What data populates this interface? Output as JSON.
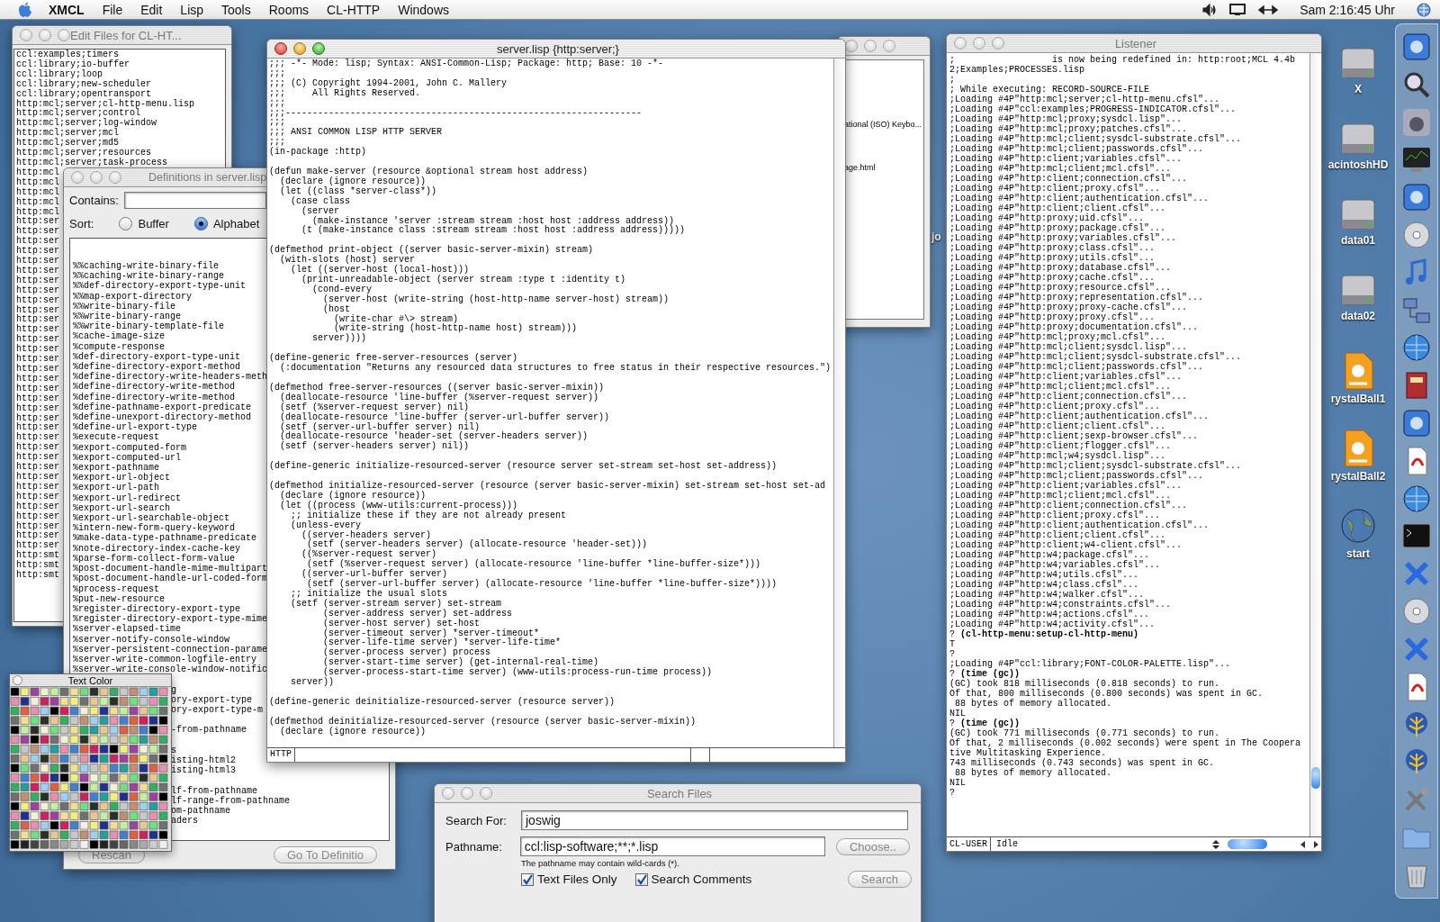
{
  "menu_bar": {
    "app": "XMCL",
    "menus": [
      "File",
      "Edit",
      "Lisp",
      "Tools",
      "Rooms",
      "CL-HTTP",
      "Windows"
    ],
    "clock": "Sam 2:16:45 Uhr"
  },
  "edit_files": {
    "title": "Edit Files for CL-HT...",
    "active": false,
    "items": [
      "ccl:examples;timers",
      "ccl:library;io-buffer",
      "ccl:library;loop",
      "ccl:library;new-scheduler",
      "ccl:library;opentransport",
      "http:mcl;server;cl-http-menu.lisp",
      "http:mcl;server;control",
      "http:mcl;server;log-window",
      "http:mcl;server;mcl",
      "http:mcl;server;md5",
      "http:mcl;server;resources",
      "http:mcl;server;task-process",
      "http:mcl",
      "http:mcl",
      "http:mcl",
      "http:mcl",
      "http:mcl",
      "http:ser",
      "http:ser",
      "http:ser",
      "http:ser",
      "http:ser",
      "http:ser",
      "http:ser",
      "http:ser",
      "http:ser",
      "http:ser",
      "http:ser",
      "http:ser",
      "http:ser",
      "http:ser",
      "http:ser",
      "http:ser",
      "http:ser",
      "http:ser",
      "http:ser",
      "http:ser",
      "http:ser",
      "http:ser",
      "http:ser",
      "http:ser",
      "http:ser",
      "http:ser",
      "http:ser",
      "http:ser",
      "http:ser",
      "http:ser",
      "http:ser",
      "http:ser",
      "http:ser",
      "http:ser",
      "http:smt",
      "http:smt",
      "http:smt"
    ]
  },
  "definitions": {
    "title": "Definitions in server.lisp",
    "active": false,
    "contains_label": "Contains:",
    "sort_label": "Sort:",
    "sort_options": [
      {
        "label": "Buffer",
        "selected": false
      },
      {
        "label": "Alphabet",
        "selected": true
      }
    ],
    "items": [
      {
        "text": "%%caching-write-binary-file",
        "kind": "entry"
      },
      {
        "text": "%%caching-write-binary-range",
        "kind": "entry"
      },
      {
        "text": "%%def-directory-export-type-unit",
        "kind": "entry"
      },
      {
        "text": "%%map-export-directory",
        "kind": "entry"
      },
      {
        "text": "%%write-binary-file",
        "kind": "entry"
      },
      {
        "text": "%%write-binary-range",
        "kind": "entry"
      },
      {
        "text": "%%write-binary-template-file",
        "kind": "entry"
      },
      {
        "text": "%cache-image-size",
        "kind": "entry"
      },
      {
        "text": "%compute-response",
        "kind": "entry"
      },
      {
        "text": "%def-directory-export-type-unit",
        "kind": "entry"
      },
      {
        "text": "%define-directory-export-method",
        "kind": "entry"
      },
      {
        "text": "%define-directory-write-headers-meth",
        "kind": "entry"
      },
      {
        "text": "%define-directory-write-method",
        "kind": "entry"
      },
      {
        "text": "%define-directory-write-method",
        "kind": "entry"
      },
      {
        "text": "%define-pathname-export-predicate",
        "kind": "entry"
      },
      {
        "text": "%define-unexport-directory-method",
        "kind": "entry"
      },
      {
        "text": "%define-url-export-type",
        "kind": "entry"
      },
      {
        "text": "%execute-request",
        "kind": "entry"
      },
      {
        "text": "%export-computed-form",
        "kind": "entry"
      },
      {
        "text": "%export-computed-url",
        "kind": "entry"
      },
      {
        "text": "%export-pathname",
        "kind": "entry"
      },
      {
        "text": "%export-url-object",
        "kind": "entry"
      },
      {
        "text": "%export-url-path",
        "kind": "entry"
      },
      {
        "text": "%export-url-redirect",
        "kind": "entry"
      },
      {
        "text": "%export-url-search",
        "kind": "entry"
      },
      {
        "text": "%export-url-searchable-object",
        "kind": "entry"
      },
      {
        "text": "%intern-new-form-query-keyword",
        "kind": "entry"
      },
      {
        "text": "%make-data-type-pathname-predicate",
        "kind": "entry"
      },
      {
        "text": "%note-directory-index-cache-key",
        "kind": "entry"
      },
      {
        "text": "%parse-form-collect-form-value",
        "kind": "entry"
      },
      {
        "text": "%post-document-handle-mime-multipart",
        "kind": "entry"
      },
      {
        "text": "%post-document-handle-url-coded-form",
        "kind": "entry"
      },
      {
        "text": "%process-request",
        "kind": "entry"
      },
      {
        "text": "%put-new-resource",
        "kind": "entry"
      },
      {
        "text": "%register-directory-export-type",
        "kind": "entry"
      },
      {
        "text": "%register-directory-export-type-mime",
        "kind": "entry"
      },
      {
        "text": "%server-elapsed-time",
        "kind": "entry"
      },
      {
        "text": "%server-notify-console-window",
        "kind": "entry"
      },
      {
        "text": "%server-persistent-connection-parame",
        "kind": "entry"
      },
      {
        "text": "%server-write-common-logfile-entry",
        "kind": "entry"
      },
      {
        "text": "%server-write-console-window-notific",
        "kind": "entry"
      },
      {
        "text": "g",
        "kind": "spaced_fragment"
      },
      {
        "text": "ory-export-type",
        "kind": "fragment"
      },
      {
        "text": "ory-export-type-m",
        "kind": "fragment"
      },
      {
        "text": "-from-pathname",
        "kind": "spaced_fragment"
      },
      {
        "text": "s",
        "kind": "spaced_fragment"
      },
      {
        "text": "isting-html2",
        "kind": "fragment"
      },
      {
        "text": "isting-html3",
        "kind": "fragment"
      },
      {
        "text": "lf-from-pathname",
        "kind": "spaced_fragment"
      },
      {
        "text": "lf-range-from-pathname",
        "kind": "fragment"
      },
      {
        "text": "om-pathname",
        "kind": "fragment"
      },
      {
        "text": "aders",
        "kind": "fragment"
      }
    ],
    "buttons": [
      "Rescan",
      "Go To Definitio"
    ]
  },
  "back_window": {
    "active": false,
    "lines": [
      "ational (ISO) Keybo...",
      "age.html"
    ]
  },
  "desktop_texts": [
    "jo"
  ],
  "desktop_icons": [
    {
      "label": "X",
      "kind": "disk"
    },
    {
      "label": "acintoshHD",
      "kind": "disk"
    },
    {
      "label": "data01",
      "kind": "disk"
    },
    {
      "label": "data02",
      "kind": "disk"
    },
    {
      "label": "rystalBall1",
      "kind": "document"
    },
    {
      "label": "rystalBall2",
      "kind": "document"
    },
    {
      "label": "start",
      "kind": "globe"
    }
  ],
  "search_files": {
    "title": "Search Files",
    "active": false,
    "search_label": "Search For:",
    "search_value": "joswig",
    "path_label": "Pathname:",
    "path_value": "ccl:lisp-software;**;*.lisp",
    "choose_button": "Choose..",
    "hint": "The pathname may contain wild-cards (*).",
    "options": [
      {
        "label": "Text Files Only",
        "checked": true
      },
      {
        "label": "Search Comments",
        "checked": true
      }
    ],
    "search_button": "Search"
  },
  "editor": {
    "title": "server.lisp {http:server;}",
    "active": true,
    "mode": "HTTP",
    "code": ";;; -*- Mode: lisp; Syntax: ANSI-Common-Lisp; Package: http; Base: 10 -*-\n;;;\n;;; (C) Copyright 1994-2001, John C. Mallery\n;;;     All Rights Reserved.\n;;;\n;;;------------------------------------------------------------------\n;;;\n;;; ANSI COMMON LISP HTTP SERVER\n;;;\n(in-package :http)\n\n(defun make-server (resource &optional stream host address)\n  (declare (ignore resource))\n  (let ((class *server-class*))\n    (case class\n      (server\n        (make-instance 'server :stream stream :host host :address address))\n      (t (make-instance class :stream stream :host host :address address)))))\n\n(defmethod print-object ((server basic-server-mixin) stream)\n  (with-slots (host) server\n    (let ((server-host (local-host)))\n      (print-unreadable-object (server stream :type t :identity t)\n        (cond-every\n          (server-host (write-string (host-http-name server-host) stream))\n          (host\n            (write-char #\\> stream)\n            (write-string (host-http-name host) stream)))\n        server))))\n\n(define-generic free-server-resources (server)\n  (:documentation \"Returns any resourced data structures to free status in their respective resources.\")\n\n(defmethod free-server-resources ((server basic-server-mixin))\n  (deallocate-resource 'line-buffer (%server-request server))\n  (setf (%server-request server) nil)\n  (deallocate-resource 'line-buffer (server-url-buffer server))\n  (setf (server-url-buffer server) nil)\n  (deallocate-resource 'header-set (server-headers server))\n  (setf (server-headers server) nil))\n\n(define-generic initialize-resourced-server (resource server set-stream set-host set-address))\n\n(defmethod initialize-resourced-server (resource (server basic-server-mixin) set-stream set-host set-ad\n  (declare (ignore resource))\n  (let ((process (www-utils:current-process)))\n    ;; initialize these if they are not already present\n    (unless-every\n      ((server-headers server)\n       (setf (server-headers server) (allocate-resource 'header-set)))\n      ((%server-request server)\n       (setf (%server-request server) (allocate-resource 'line-buffer *line-buffer-size*)))\n      ((server-url-buffer server)\n       (setf (server-url-buffer server) (allocate-resource 'line-buffer *line-buffer-size*))))\n    ;; initialize the usual slots\n    (setf (server-stream server) set-stream\n          (server-address server) set-address\n          (server-host server) set-host\n          (server-timeout server) *server-timeout*\n          (server-life-time server) *server-life-time*\n          (server-process server) process\n          (server-start-time server) (get-internal-real-time)\n          (server-process-start-time server) (www-utils:process-run-time process))\n    server))\n\n(define-generic deinitialize-resourced-server (resource server))\n\n(defmethod deinitialize-resourced-server (resource (server basic-server-mixin))\n  (declare (ignore resource))"
  },
  "listener": {
    "title": "Listener",
    "active": false,
    "package": "CL-USER",
    "status": "Idle",
    "lines": [
      ";                  is now being redefined in: http:root;MCL 4.4b",
      "2;Examples;PROCESSES.lisp",
      ";",
      "; While executing: RECORD-SOURCE-FILE",
      ";Loading #4P\"http:mcl;server;cl-http-menu.cfsl\"...",
      ";Loading #4P\"ccl:examples;PROGRESS-INDICATOR.cfsl\"...",
      ";Loading #4P\"http:mcl;proxy;sysdcl.lisp\"...",
      ";Loading #4P\"http:mcl;proxy;patches.cfsl\"...",
      ";Loading #4P\"http:mcl;client;sysdcl-substrate.cfsl\"...",
      ";Loading #4P\"http:mcl;client;passwords.cfsl\"...",
      ";Loading #4P\"http:client;variables.cfsl\"...",
      ";Loading #4P\"http:mcl;client;mcl.cfsl\"...",
      ";Loading #4P\"http:client;connection.cfsl\"...",
      ";Loading #4P\"http:client;proxy.cfsl\"...",
      ";Loading #4P\"http:client;authentication.cfsl\"...",
      ";Loading #4P\"http:client;client.cfsl\"...",
      ";Loading #4P\"http:proxy;uid.cfsl\"...",
      ";Loading #4P\"http:proxy;package.cfsl\"...",
      ";Loading #4P\"http:proxy;variables.cfsl\"...",
      ";Loading #4P\"http:proxy;class.cfsl\"...",
      ";Loading #4P\"http:proxy;utils.cfsl\"...",
      ";Loading #4P\"http:proxy;database.cfsl\"...",
      ";Loading #4P\"http:proxy;cache.cfsl\"...",
      ";Loading #4P\"http:proxy;resource.cfsl\"...",
      ";Loading #4P\"http:proxy;representation.cfsl\"...",
      ";Loading #4P\"http:proxy;proxy-cache.cfsl\"...",
      ";Loading #4P\"http:proxy;proxy.cfsl\"...",
      ";Loading #4P\"http:proxy;documentation.cfsl\"...",
      ";Loading #4P\"http:mcl;proxy;mcl.cfsl\"...",
      ";Loading #4P\"http:mcl;client;sysdcl.lisp\"...",
      ";Loading #4P\"http:mcl;client;sysdcl-substrate.cfsl\"...",
      ";Loading #4P\"http:mcl;client;passwords.cfsl\"...",
      ";Loading #4P\"http:client;variables.cfsl\"...",
      ";Loading #4P\"http:mcl;client;mcl.cfsl\"...",
      ";Loading #4P\"http:client;connection.cfsl\"...",
      ";Loading #4P\"http:client;proxy.cfsl\"...",
      ";Loading #4P\"http:client;authentication.cfsl\"...",
      ";Loading #4P\"http:client;client.cfsl\"...",
      ";Loading #4P\"http:client;sexp-browser.cfsl\"...",
      ";Loading #4P\"http:client;flogger.cfsl\"...",
      ";Loading #4P\"http:mcl;w4;sysdcl.lisp\"...",
      ";Loading #4P\"http:mcl;client;sysdcl-substrate.cfsl\"...",
      ";Loading #4P\"http:mcl;client;passwords.cfsl\"...",
      ";Loading #4P\"http:client;variables.cfsl\"...",
      ";Loading #4P\"http:mcl;client;mcl.cfsl\"...",
      ";Loading #4P\"http:client;connection.cfsl\"...",
      ";Loading #4P\"http:client;proxy.cfsl\"...",
      ";Loading #4P\"http:client;authentication.cfsl\"...",
      ";Loading #4P\"http:client;client.cfsl\"...",
      ";Loading #4P\"http:client;w4-client.cfsl\"...",
      ";Loading #4P\"http:w4;package.cfsl\"...",
      ";Loading #4P\"http:w4;variables.cfsl\"...",
      ";Loading #4P\"http:w4;utils.cfsl\"...",
      ";Loading #4P\"http:w4;class.cfsl\"...",
      ";Loading #4P\"http:w4;walker.cfsl\"...",
      ";Loading #4P\"http:w4;constraints.cfsl\"...",
      ";Loading #4P\"http:w4;actions.cfsl\"...",
      ";Loading #4P\"http:w4;activity.cfsl\"...",
      "? **(cl-http-menu:setup-cl-http-menu)**",
      "T",
      "?",
      ";Loading #4P\"ccl:library;FONT-COLOR-PALETTE.lisp\"...",
      "? **(time (gc))**",
      "(GC) took 818 milliseconds (0.818 seconds) to run.",
      "Of that, 800 milliseconds (0.800 seconds) was spent in GC.",
      " 88 bytes of memory allocated.",
      "NIL",
      "? **(time (gc))**",
      "(GC) took 771 milliseconds (0.771 seconds) to run.",
      "Of that, 2 milliseconds (0.002 seconds) were spent in The Coopera",
      "tive Multitasking Experience.",
      "743 milliseconds (0.743 seconds) was spent in GC.",
      " 88 bytes of memory allocated.",
      "NIL",
      "?"
    ]
  },
  "text_color": {
    "title": "Text Color"
  }
}
